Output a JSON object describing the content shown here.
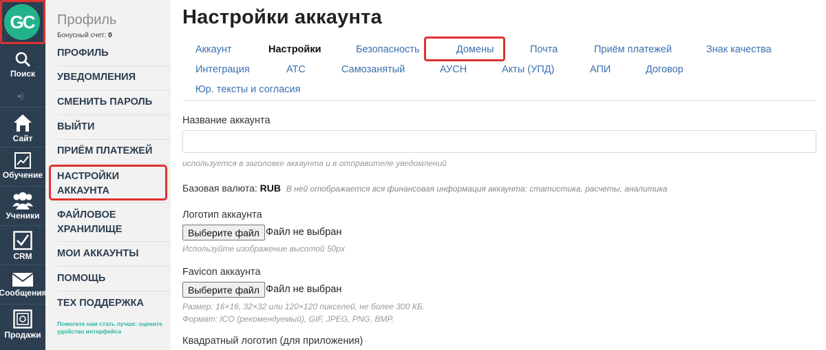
{
  "rail": {
    "logo": "GC",
    "items": [
      {
        "label": "Поиск",
        "icon": "search-icon"
      },
      {
        "label": "Сайт",
        "icon": "home-icon"
      },
      {
        "label": "Обучение",
        "icon": "chart-icon"
      },
      {
        "label": "Ученики",
        "icon": "users-icon"
      },
      {
        "label": "CRM",
        "icon": "checkbox-icon"
      },
      {
        "label": "Сообщения",
        "icon": "envelope-icon"
      },
      {
        "label": "Продажи",
        "icon": "safe-icon"
      }
    ]
  },
  "sidebar": {
    "title": "Профиль",
    "bonus_label": "Бонусный счет:",
    "bonus_value": "0",
    "items": [
      {
        "label": "ПРОФИЛЬ"
      },
      {
        "label": "УВЕДОМЛЕНИЯ"
      },
      {
        "label": "СМЕНИТЬ ПАРОЛЬ"
      },
      {
        "label": "ВЫЙТИ"
      },
      {
        "label": "ПРИЁМ ПЛАТЕЖЕЙ"
      },
      {
        "label": "НАСТРОЙКИ АККАУНТА"
      },
      {
        "label": "ФАЙЛОВОЕ ХРАНИЛИЩЕ"
      },
      {
        "label": "МОИ АККАУНТЫ"
      },
      {
        "label": "ПОМОЩЬ"
      },
      {
        "label": "ТЕХ ПОДДЕРЖКА"
      }
    ],
    "help_text": "Помогите нам стать лучше: оцените удобство интерфейса"
  },
  "main": {
    "title": "Настройки аккаунта",
    "tabs": [
      {
        "label": "Аккаунт"
      },
      {
        "label": "Настройки"
      },
      {
        "label": "Безопасность"
      },
      {
        "label": "Домены"
      },
      {
        "label": "Почта"
      },
      {
        "label": "Приём платежей"
      },
      {
        "label": "Знак качества"
      },
      {
        "label": "Интеграция"
      },
      {
        "label": "АТС"
      },
      {
        "label": "Самозанятый"
      },
      {
        "label": "АУСН"
      },
      {
        "label": "Акты (УПД)"
      },
      {
        "label": "АПИ"
      },
      {
        "label": "Договор"
      },
      {
        "label": "Юр. тексты и согласия"
      }
    ],
    "account_name": {
      "label": "Название аккаунта",
      "value": "",
      "hint": "используется в заголовке аккаунта и в отправителе уведомлений"
    },
    "currency": {
      "label": "Базовая валюта:",
      "value": "RUB",
      "hint": "В ней отображается вся финансовая информация аккаунта: статистика, расчеты, аналитика"
    },
    "logo": {
      "label": "Логотип аккаунта",
      "button": "Выберите файл",
      "status": "Файл не выбран",
      "hint": "Используйте изображение высотой 50px"
    },
    "favicon": {
      "label": "Favicon аккаунта",
      "button": "Выберите файл",
      "status": "Файл не выбран",
      "hint_size": "Размер: 16×16, 32×32 или 120×120 пикселей, не более 300 КБ.",
      "hint_format": "Формат: ICO (рекомендуемый), GIF, JPEG, PNG, BMP."
    },
    "square_logo": {
      "label": "Квадратный логотип (для приложения)"
    }
  }
}
